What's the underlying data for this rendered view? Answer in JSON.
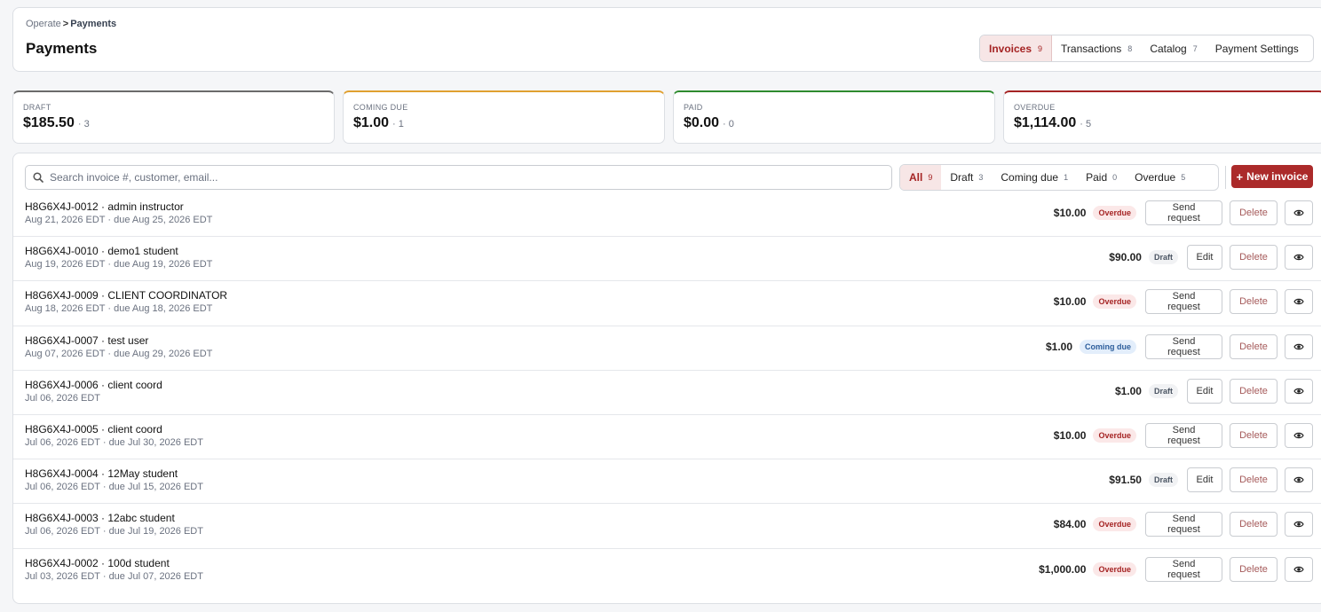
{
  "breadcrumb": {
    "parent": "Operate",
    "separator": ">",
    "current": "Payments"
  },
  "page_title": "Payments",
  "nav_tabs": [
    {
      "label": "Invoices",
      "count": "9"
    },
    {
      "label": "Transactions",
      "count": "8"
    },
    {
      "label": "Catalog",
      "count": "7"
    },
    {
      "label": "Payment Settings",
      "count": ""
    }
  ],
  "stats": [
    {
      "label": "DRAFT",
      "value": "$185.50",
      "count": "· 3",
      "color": "#6b6b6b"
    },
    {
      "label": "COMING DUE",
      "value": "$1.00",
      "count": "· 1",
      "color": "#e0a030"
    },
    {
      "label": "PAID",
      "value": "$0.00",
      "count": "· 0",
      "color": "#2e8b2e"
    },
    {
      "label": "OVERDUE",
      "value": "$1,114.00",
      "count": "· 5",
      "color": "#a52424"
    }
  ],
  "search": {
    "placeholder": "Search invoice #, customer, email..."
  },
  "filters": [
    {
      "label": "All",
      "count": "9"
    },
    {
      "label": "Draft",
      "count": "3"
    },
    {
      "label": "Coming due",
      "count": "1"
    },
    {
      "label": "Paid",
      "count": "0"
    },
    {
      "label": "Overdue",
      "count": "5"
    }
  ],
  "new_invoice_label": "New invoice",
  "actions": {
    "send": "Send request",
    "edit": "Edit",
    "delete": "Delete"
  },
  "invoices": [
    {
      "title": "H8G6X4J-0012 · admin instructor",
      "dates": "Aug 21, 2026 EDT · due Aug 25, 2026 EDT",
      "amount": "$10.00",
      "status": "Overdue"
    },
    {
      "title": "H8G6X4J-0010 · demo1 student",
      "dates": "Aug 19, 2026 EDT · due Aug 19, 2026 EDT",
      "amount": "$90.00",
      "status": "Draft"
    },
    {
      "title": "H8G6X4J-0009 · CLIENT COORDINATOR",
      "dates": "Aug 18, 2026 EDT · due Aug 18, 2026 EDT",
      "amount": "$10.00",
      "status": "Overdue"
    },
    {
      "title": "H8G6X4J-0007 · test user",
      "dates": "Aug 07, 2026 EDT · due Aug 29, 2026 EDT",
      "amount": "$1.00",
      "status": "Coming due"
    },
    {
      "title": "H8G6X4J-0006 · client coord",
      "dates": "Jul 06, 2026 EDT",
      "amount": "$1.00",
      "status": "Draft"
    },
    {
      "title": "H8G6X4J-0005 · client coord",
      "dates": "Jul 06, 2026 EDT · due Jul 30, 2026 EDT",
      "amount": "$10.00",
      "status": "Overdue"
    },
    {
      "title": "H8G6X4J-0004 · 12May student",
      "dates": "Jul 06, 2026 EDT · due Jul 15, 2026 EDT",
      "amount": "$91.50",
      "status": "Draft"
    },
    {
      "title": "H8G6X4J-0003 · 12abc student",
      "dates": "Jul 06, 2026 EDT · due Jul 19, 2026 EDT",
      "amount": "$84.00",
      "status": "Overdue"
    },
    {
      "title": "H8G6X4J-0002 · 100d student",
      "dates": "Jul 03, 2026 EDT · due Jul 07, 2026 EDT",
      "amount": "$1,000.00",
      "status": "Overdue"
    }
  ]
}
